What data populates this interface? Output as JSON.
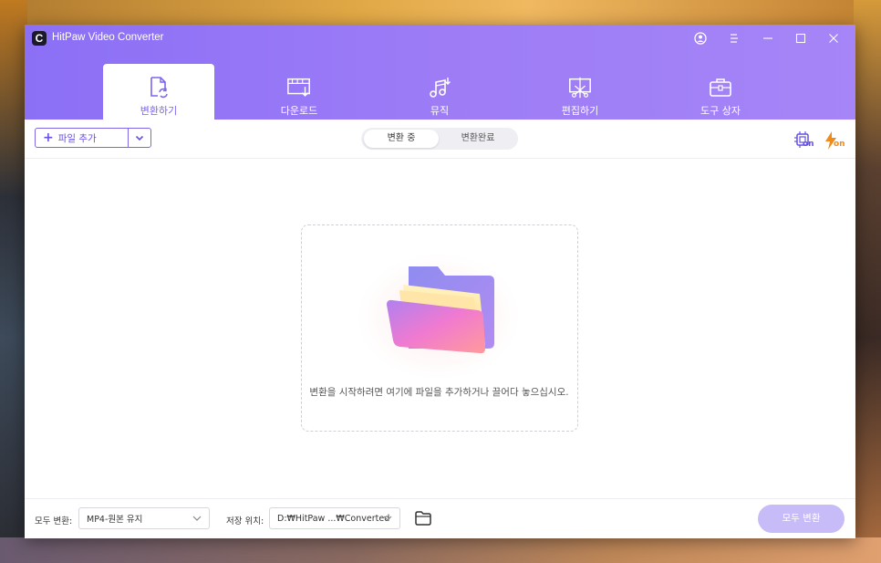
{
  "app": {
    "logo_letter": "C",
    "title": "HitPaw Video Converter"
  },
  "titlebar": {
    "icons": [
      "account-icon",
      "menu-icon",
      "minimize-icon",
      "maximize-icon",
      "close-icon"
    ]
  },
  "tabs": [
    {
      "label": "변환하기",
      "icon": "convert-icon",
      "active": true
    },
    {
      "label": "다운로드",
      "icon": "download-icon",
      "active": false
    },
    {
      "label": "뮤직",
      "icon": "music-icon",
      "active": false
    },
    {
      "label": "편집하기",
      "icon": "edit-icon",
      "active": false
    },
    {
      "label": "도구 상자",
      "icon": "toolbox-icon",
      "active": false
    }
  ],
  "toolbar": {
    "add_file": "파일 추가",
    "segment": {
      "converting": "변환 중",
      "converted": "변환완료",
      "selected": "변환 중"
    },
    "hw_accel_icon": "hardware-acceleration-on-icon",
    "speed_icon": "high-speed-on-icon",
    "on_text": "on"
  },
  "dropzone": {
    "text": "변환을 시작하려면 여기에 파일을 추가하거나 끌어다 놓으십시오."
  },
  "footer": {
    "convert_all_label": "모두 변환:",
    "format_value": "MP4-원본 유지",
    "save_label": "저장 위치:",
    "save_path": "D:₩HitPaw ...₩Converted",
    "convert_button": "모두 변환"
  },
  "colors": {
    "accent": "#8b6ff5",
    "accent_text": "#7d63f0",
    "hw_icon": "#6651e3",
    "speed_icon": "#f28a1a"
  }
}
